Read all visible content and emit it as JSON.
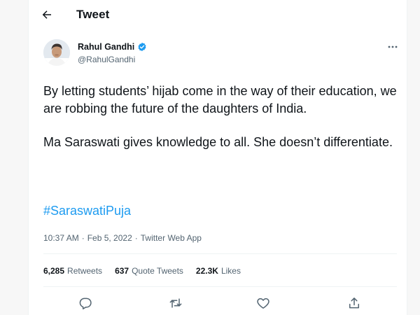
{
  "header": {
    "back_icon": "arrow-left-icon",
    "title": "Tweet"
  },
  "author": {
    "name": "Rahul Gandhi",
    "verified_icon": "verified-badge-icon",
    "handle": "@RahulGandhi"
  },
  "more_icon": "more-horizontal-icon",
  "tweet": {
    "paragraph_1": "By letting students’ hijab come in the way of their education, we are robbing the future of the daughters of India.",
    "paragraph_2": "Ma Saraswati gives knowledge to all. She doesn’t differentiate.",
    "hashtag": "#SaraswatiPuja"
  },
  "meta": {
    "time": "10:37 AM",
    "separator_1": "·",
    "date": "Feb 5, 2022",
    "separator_2": "·",
    "source": "Twitter Web App"
  },
  "stats": {
    "retweets_count": "6,285",
    "retweets_label": "Retweets",
    "quotes_count": "637",
    "quotes_label": "Quote Tweets",
    "likes_count": "22.3K",
    "likes_label": "Likes"
  },
  "actions": [
    "reply-icon",
    "retweet-icon",
    "like-icon",
    "share-icon"
  ],
  "colors": {
    "accent": "#1d9bf0",
    "text_primary": "#0f1419",
    "text_secondary": "#536471",
    "divider": "#eff3f4",
    "background": "#ffffff"
  }
}
